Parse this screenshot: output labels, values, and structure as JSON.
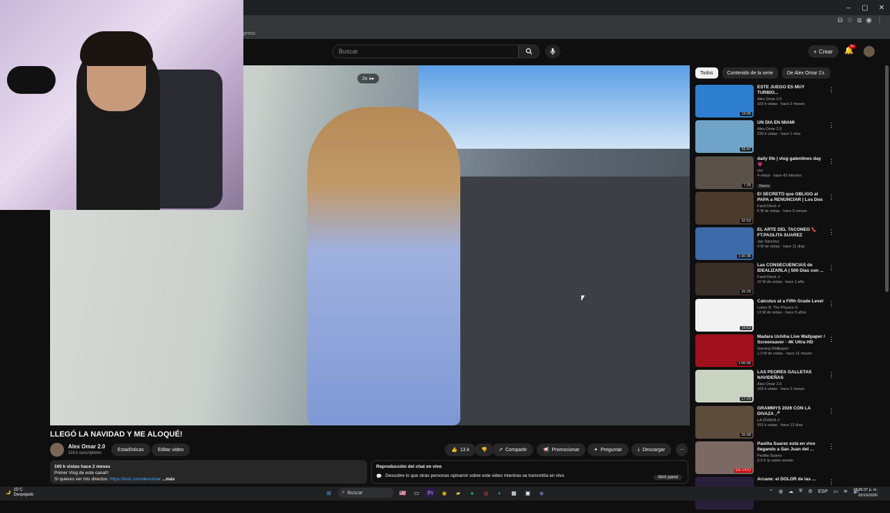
{
  "browser": {
    "bookmark_fragment": "press",
    "window_controls": [
      "–",
      "▢",
      "✕"
    ]
  },
  "header": {
    "search_placeholder": "Buscar",
    "create_label": "Crear",
    "notif_count": "9+"
  },
  "player": {
    "speed_label": "2x"
  },
  "video": {
    "title": "LLEGÓ LA NAVIDAD Y ME ALOQUÉ!",
    "channel": "Alex Omar 2.0",
    "subscribers": "118 k suscriptores",
    "stats_button": "Estadísticas",
    "edit_button": "Editar video",
    "likes": "13 k",
    "share": "Compartir",
    "promote": "Promocionar",
    "ask": "Preguntar",
    "download": "Descargar"
  },
  "description": {
    "meta": "160 k vistas  hace 2 meses",
    "line1": "Primer Vlog de este canal!!",
    "line2_prefix": "Si quieres ver mis directos: ",
    "link": "https://kick.com/alexomar",
    "more": " ...más"
  },
  "chat_replay": {
    "title": "Reproducción del chat en vivo",
    "text": "Descubre lo que otras personas opinaron sobre este video mientras se transmitía en vivo.",
    "open": "Abrir panel"
  },
  "chips": [
    "Todos",
    "Contenido de la serie",
    "De Alex Omar 2..."
  ],
  "recommendations": [
    {
      "title": "ESTE JUEGO ES MUY TURBIO...",
      "channel": "Alex Omar 2.0",
      "meta": "103 k vistas · hace 2 meses",
      "duration": "19:06",
      "color": "#2f7fd0"
    },
    {
      "title": "UN DÍA EN MIAMI",
      "channel": "Alex Omar 2.0",
      "meta": "239 k vistas · hace 1 mes",
      "duration": "16:47",
      "color": "#6fa3c8"
    },
    {
      "title": "daily life | vlog galentines day 💗",
      "channel": "vivi",
      "meta": "4 vistas · hace 43 minutos",
      "duration": "7:25",
      "color": "#5a5248",
      "badge": "Nuevo"
    },
    {
      "title": "El SECRETO que OBLIGÓ al PAPA a RENUNCIAR | Los Dos ...",
      "channel": "Farid Dieck ✔",
      "meta": "5 M de vistas · hace 5 meses",
      "duration": "32:53",
      "color": "#4a3b2e"
    },
    {
      "title": "EL ARTE DEL TACONEO 👠 FT.PAOLITA SUAREZ",
      "channel": "Jair Sánchez",
      "meta": "4 M de vistas · hace 11 días",
      "duration": "1:00:36",
      "color": "#3d6aa8"
    },
    {
      "title": "Las CONSECUENCIAS de IDEALIZARLA | 500 Días con ...",
      "channel": "Farid Dieck ✔",
      "meta": "10 M de vistas · hace 1 año",
      "duration": "26:29",
      "color": "#3a2f28"
    },
    {
      "title": "Calculus at a Fifth Grade Level",
      "channel": "Lukey B. The Physics G",
      "meta": "13 M de vistas · hace 8 años",
      "duration": "19:53",
      "color": "#f2f2f2"
    },
    {
      "title": "Madara Uchiha Live Wallpaper / Screensaver - 4K Ultra HD",
      "channel": "Gaming Wallpaper",
      "meta": "1.2 M de vistas · hace 11 meses",
      "duration": "1:00:00",
      "color": "#a0101c"
    },
    {
      "title": "LAS PEORES GALLETAS NAVIDEÑAS",
      "channel": "Alex Omar 2.0",
      "meta": "169 k vistas · hace 2 meses",
      "duration": "17:29",
      "color": "#c9d3c2"
    },
    {
      "title": "GRAMMYS 2026 CON LA DIVAZA 🎤",
      "channel": "LA DIVAZA ✔",
      "meta": "915 k vistas · hace 12 días",
      "duration": "25:08",
      "color": "#5b4c3c"
    },
    {
      "title": "Paolita Suarez está en vivo llegando a San Juan del ...",
      "channel": "Paolita Suarez",
      "meta": "9.6 K te están viendo",
      "duration": "EN VIVO",
      "color": "#7a6a63",
      "live": true
    },
    {
      "title": "Arcane: el DOLOR de las ...",
      "channel": "",
      "meta": "",
      "duration": "",
      "color": "#2a1f3a"
    }
  ],
  "taskbar": {
    "temp": "25°C",
    "weather": "Despejado",
    "search": "Buscar",
    "lang": "ESP",
    "time": "11:35:37 p. m.",
    "date": "02/16/2026"
  },
  "colors": {
    "bg": "#0f0f0f",
    "accent_red": "#cc0000",
    "link": "#3ea6ff"
  }
}
